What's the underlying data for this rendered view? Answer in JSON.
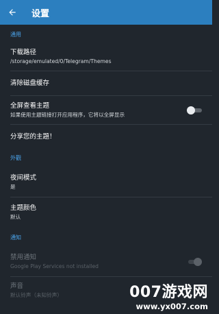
{
  "header": {
    "title": "设置",
    "back_icon": "arrow-back-icon",
    "background": "#2c7fbf"
  },
  "sections": {
    "general": "通用",
    "appearance": "外觀",
    "notifications": "通知"
  },
  "rows": {
    "download_path": {
      "title": "下载路径",
      "subtitle": "/storage/emulated/0/Telegram/Themes"
    },
    "clear_cache": {
      "title": "清除磁盘缓存"
    },
    "fullscreen_theme": {
      "title": "全屏查看主题",
      "subtitle": "如果使用主题链接打开应用程序，它将以全屏显示",
      "toggle_on": false
    },
    "share_theme": {
      "title": "分享您的主題！"
    },
    "night_mode": {
      "title": "夜间模式",
      "subtitle": "是"
    },
    "theme_color": {
      "title": "主题颜色",
      "subtitle": "默认"
    },
    "disable_notifications": {
      "title": "禁用通知",
      "subtitle": "Google Play Services not installed",
      "toggle_on": false,
      "disabled": true
    },
    "sound": {
      "title": "声音",
      "subtitle": "默认铃声（未知铃声）",
      "disabled": true
    }
  },
  "watermark": {
    "main": "007游戏网",
    "url": "www.yx007.com"
  },
  "colors": {
    "accent": "#4aa3ea",
    "background": "#20262d",
    "divider": "#343b43"
  }
}
